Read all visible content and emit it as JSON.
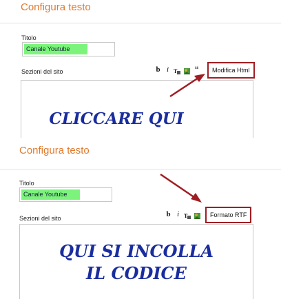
{
  "panels": {
    "top": {
      "heading": "Configura testo",
      "title_label": "Titolo",
      "title_value": "Canale Youtube",
      "content_label": "Sezioni del sito",
      "mode_button": "Modifica Html",
      "editor_text": "CLICCARE QUI"
    },
    "bottom": {
      "heading": "Configura testo",
      "title_label": "Titolo",
      "title_value": "Canale Youtube",
      "content_label": "Sezioni del sito",
      "mode_button": "Formato RTF",
      "editor_text_line1": "QUI SI INCOLLA",
      "editor_text_line2": "IL CODICE"
    }
  },
  "toolbar": {
    "bold": "b",
    "italic": "i",
    "icons": [
      "font-color-icon",
      "insert-image-icon",
      "quote-icon"
    ],
    "quote_glyph": "❝"
  },
  "colors": {
    "heading": "#e07a2e",
    "highlight": "#7cf47c",
    "annotation": "#a01d22",
    "editor_text": "#1a2d9e"
  }
}
